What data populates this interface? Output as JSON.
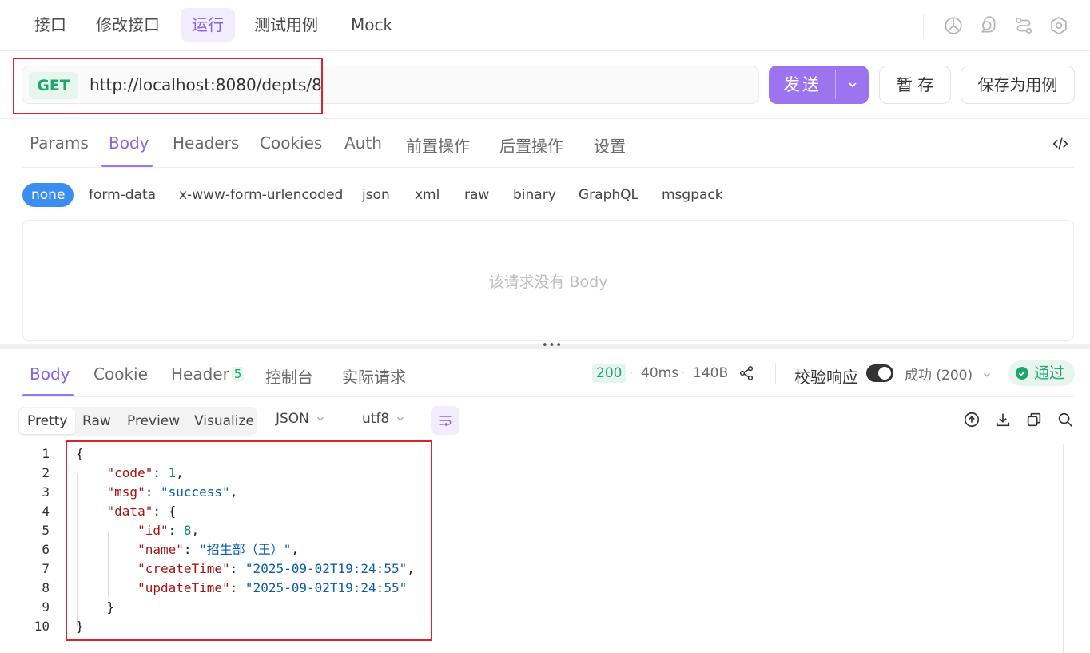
{
  "top_tabs": [
    {
      "label": "接口"
    },
    {
      "label": "修改接口"
    },
    {
      "label": "运行"
    },
    {
      "label": "测试用例"
    },
    {
      "label": "Mock"
    }
  ],
  "request": {
    "method": "GET",
    "url": "http://localhost:8080/depts/8",
    "send_label": "发送",
    "save_label": "暂 存",
    "save_case_label": "保存为用例"
  },
  "request_tabs": [
    "Params",
    "Body",
    "Headers",
    "Cookies",
    "Auth",
    "前置操作",
    "后置操作",
    "设置"
  ],
  "body_types": [
    "none",
    "form-data",
    "x-www-form-urlencoded",
    "json",
    "xml",
    "raw",
    "binary",
    "GraphQL",
    "msgpack"
  ],
  "empty_body_text": "该请求没有 Body",
  "response_tabs": {
    "body": "Body",
    "cookie": "Cookie",
    "header": "Header",
    "header_count": "5",
    "console": "控制台",
    "actual": "实际请求"
  },
  "response_meta": {
    "status": "200",
    "time": "40ms",
    "size": "140B",
    "verify_label": "校验响应",
    "result_select": "成功 (200)",
    "pass_label": "通过"
  },
  "view_modes": [
    "Pretty",
    "Raw",
    "Preview",
    "Visualize"
  ],
  "format_select": "JSON",
  "encoding_select": "utf8",
  "code_lines": [
    {
      "n": "1",
      "parts": [
        [
          "p",
          "{"
        ]
      ]
    },
    {
      "n": "2",
      "parts": [
        [
          "p",
          "    "
        ],
        [
          "k",
          "\"code\""
        ],
        [
          "p",
          ": "
        ],
        [
          "n",
          "1"
        ],
        [
          "p",
          ","
        ]
      ]
    },
    {
      "n": "3",
      "parts": [
        [
          "p",
          "    "
        ],
        [
          "k",
          "\"msg\""
        ],
        [
          "p",
          ": "
        ],
        [
          "s",
          "\"success\""
        ],
        [
          "p",
          ","
        ]
      ]
    },
    {
      "n": "4",
      "parts": [
        [
          "p",
          "    "
        ],
        [
          "k",
          "\"data\""
        ],
        [
          "p",
          ": {"
        ]
      ]
    },
    {
      "n": "5",
      "parts": [
        [
          "p",
          "        "
        ],
        [
          "k",
          "\"id\""
        ],
        [
          "p",
          ": "
        ],
        [
          "n",
          "8"
        ],
        [
          "p",
          ","
        ]
      ]
    },
    {
      "n": "6",
      "parts": [
        [
          "p",
          "        "
        ],
        [
          "k",
          "\"name\""
        ],
        [
          "p",
          ": "
        ],
        [
          "s",
          "\"招生部（王）\""
        ],
        [
          "p",
          ","
        ]
      ]
    },
    {
      "n": "7",
      "parts": [
        [
          "p",
          "        "
        ],
        [
          "k",
          "\"createTime\""
        ],
        [
          "p",
          ": "
        ],
        [
          "s",
          "\"2025-09-02T19:24:55\""
        ],
        [
          "p",
          ","
        ]
      ]
    },
    {
      "n": "8",
      "parts": [
        [
          "p",
          "        "
        ],
        [
          "k",
          "\"updateTime\""
        ],
        [
          "p",
          ": "
        ],
        [
          "s",
          "\"2025-09-02T19:24:55\""
        ]
      ]
    },
    {
      "n": "9",
      "parts": [
        [
          "p",
          "    }"
        ]
      ]
    },
    {
      "n": "10",
      "parts": [
        [
          "p",
          "}"
        ]
      ]
    }
  ],
  "colors": {
    "accent": "#9c74ef",
    "method_get": "#1fa56f",
    "highlight_box": "#d9232d",
    "body_type_active": "#3b8ef0"
  }
}
